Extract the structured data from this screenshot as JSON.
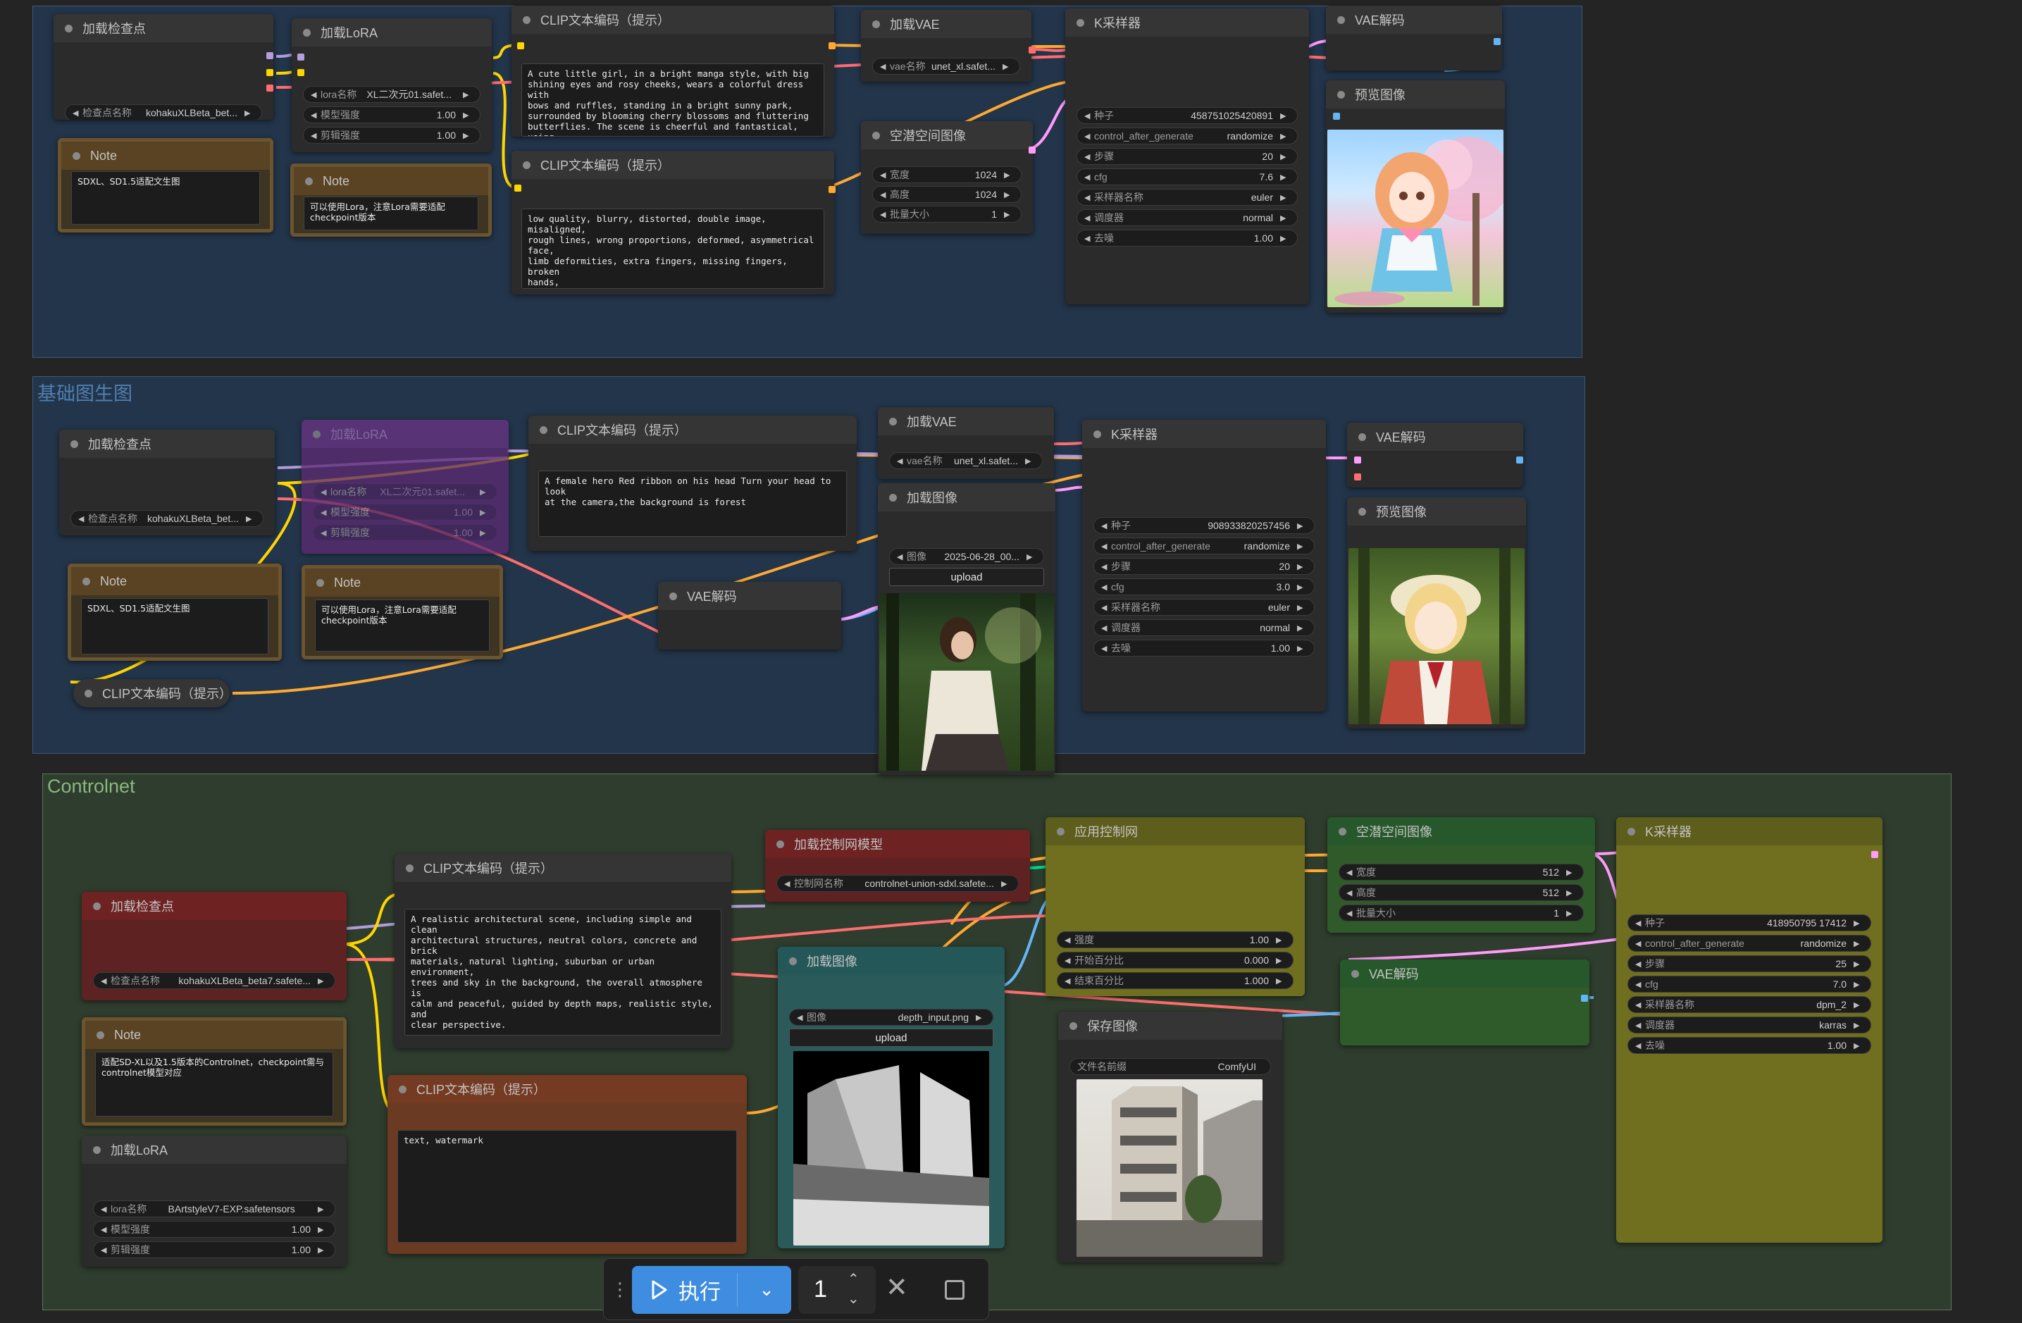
{
  "groups": {
    "basic": {
      "title": "基础图生图"
    },
    "controlnet": {
      "title": "Controlnet"
    }
  },
  "labels": {
    "load_checkpoint": "加载检查点",
    "load_lora": "加载LoRA",
    "clip_text": "CLIP文本编码（提示）",
    "load_vae": "加载VAE",
    "ksampler": "K采样器",
    "vae_decode": "VAE解码",
    "preview_image": "预览图像",
    "latent_image": "空潜空间图像",
    "note": "Note",
    "load_image": "加载图像",
    "load_controlnet": "加载控制网模型",
    "apply_controlnet": "应用控制网",
    "save_image": "保存图像",
    "ckpt_name": "检查点名称",
    "lora_name": "lora名称",
    "model_strength": "模型强度",
    "clip_strength": "剪辑强度",
    "vae_name": "vae名称",
    "width": "宽度",
    "height": "高度",
    "batch": "批量大小",
    "seed": "种子",
    "control_after": "control_after_generate",
    "steps": "步骤",
    "cfg": "cfg",
    "sampler_name": "采样器名称",
    "scheduler": "调度器",
    "denoise": "去噪",
    "image": "图像",
    "upload": "upload",
    "strength": "强度",
    "start_percent": "开始百分比",
    "end_percent": "结束百分比",
    "controlnet_name": "控制网名称",
    "filename_prefix": "文件名前缀"
  },
  "top": {
    "ckpt_value": "kohakuXLBeta_bet...",
    "note_text": "SDXL、SD1.5适配文生图",
    "lora_value": "XL二次元01.safet...",
    "lora_model": "1.00",
    "lora_clip": "1.00",
    "lora_note": "可以使用Lora，注意Lora需要适配checkpoint版本",
    "positive": "A cute little girl, in a bright manga style, with big\nshining eyes and rosy cheeks, wears a colorful dress with\nbows and ruffles, standing in a bright sunny park,\nsurrounded by blooming cherry blossoms and fluttering\nbutterflies. The scene is cheerful and fantastical, using\nsoft pastel tones, and the lines are vivid and expressive,\nwith charming cartoon details. With a clear blue sky and",
    "negative": "low quality, blurry, distorted, double image, misaligned,\nrough lines, wrong proportions, deformed, asymmetrical\nface,\nlimb deformities, extra fingers, missing fingers, broken\nhands,\nwarped face, uneven eyes, stiff expression,\nmessy background, noise, black and white, grayscale,\nover-shadowed, dark, cluttered background,",
    "vae_value": "unet_xl.safet...",
    "width": "1024",
    "height": "1024",
    "batch": "1",
    "seed": "458751025420891",
    "control": "randomize",
    "steps": "20",
    "cfg": "7.6",
    "sampler": "euler",
    "scheduler": "normal",
    "denoise": "1.00"
  },
  "mid": {
    "ckpt_value": "kohakuXLBeta_bet...",
    "lora_value": "XL二次元01.safet...",
    "lora_model": "1.00",
    "lora_clip": "1.00",
    "positive": "A female hero Red ribbon on his head Turn your head to look\nat the camera,the background is forest",
    "vae_value": "unet_xl.safet...",
    "image_value": "2025-06-28_00...",
    "note_text": "SDXL、SD1.5适配文生图",
    "lora_note": "可以使用Lora，注意Lora需要适配checkpoint版本",
    "seed": "908933820257456",
    "control": "randomize",
    "steps": "20",
    "cfg": "3.0",
    "sampler": "euler",
    "scheduler": "normal",
    "denoise": "1.00"
  },
  "cn": {
    "ckpt_value": "kohakuXLBeta_beta7.safete...",
    "note_text": "适配SD-XL以及1.5版本的Controlnet，checkpoint需与controlnet模型对应",
    "lora_value": "BArtstyleV7-EXP.safetensors",
    "lora_model": "1.00",
    "lora_clip": "1.00",
    "positive": "A realistic architectural scene, including simple and clean\narchitectural structures, neutral colors, concrete and brick\nmaterials, natural lighting, suburban or urban environment,\ntrees and sky in the background, the overall atmosphere is\ncalm and peaceful, guided by depth maps, realistic style, and\nclear perspective.",
    "negative": "text, watermark",
    "controlnet_value": "controlnet-union-sdxl.safete...",
    "image_value": "depth_input.png",
    "strength": "1.00",
    "start": "0.000",
    "end": "1.000",
    "width": "512",
    "height": "512",
    "batch": "1",
    "prefix": "ComfyUI",
    "seed": "418950795 17412",
    "control": "randomize",
    "steps": "25",
    "cfg": "7.0",
    "sampler": "dpm_2",
    "scheduler": "karras",
    "denoise": "1.00"
  },
  "toolbar": {
    "run_label": "执行",
    "count": "1"
  },
  "colors": {
    "model": "#b39ddb",
    "clip": "#ffd500",
    "vae": "#ff6e6e",
    "latent": "#ff9cf9",
    "image": "#64b5f6",
    "conditioning": "#ffa931",
    "control": "#00d78d"
  }
}
